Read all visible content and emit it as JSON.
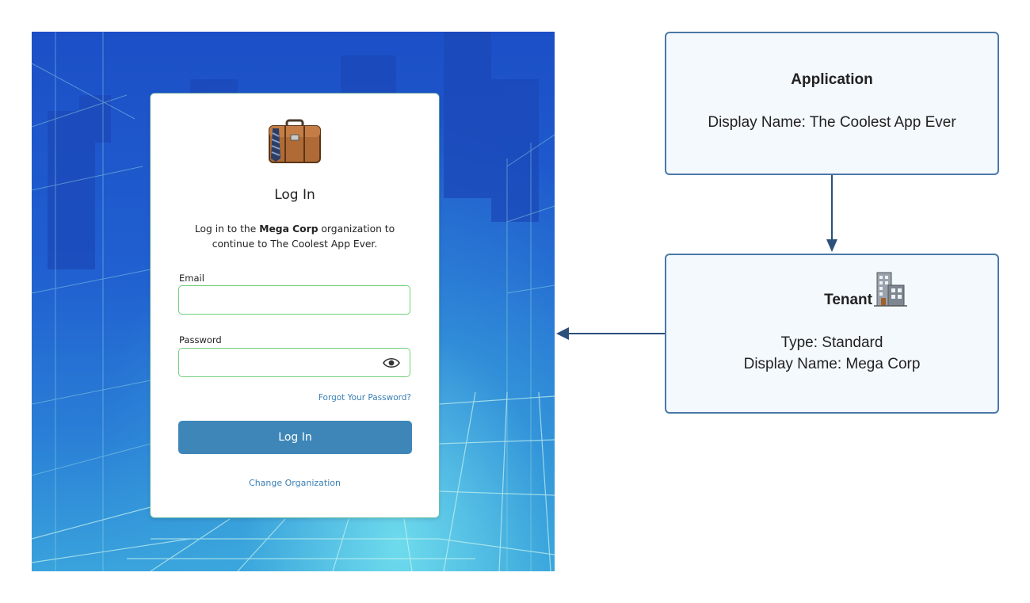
{
  "login": {
    "title": "Log In",
    "subtitle_prefix": "Log in to the ",
    "org_name": "Mega Corp",
    "subtitle_mid": " organization to",
    "subtitle_line2": "continue to The Coolest App Ever.",
    "email_label": "Email",
    "email_value": "",
    "password_label": "Password",
    "password_value": "",
    "forgot_link": "Forgot Your Password?",
    "login_button": "Log In",
    "change_org_link": "Change Organization",
    "logo_icon": "briefcase-icon",
    "show_password_icon": "eye-icon"
  },
  "diagram": {
    "application": {
      "heading": "Application",
      "display_name": "Display Name: The Coolest App Ever"
    },
    "tenant": {
      "heading": "Tenant",
      "icon": "office-building-icon",
      "type": "Type: Standard",
      "display_name": "Display Name: Mega Corp"
    },
    "colors": {
      "box_border": "#4a78a8",
      "box_fill": "#f4f9fe",
      "arrow": "#2d4f7c",
      "button": "#3e86b7",
      "field_border": "#6fd07a",
      "link": "#3a7fb5"
    }
  }
}
